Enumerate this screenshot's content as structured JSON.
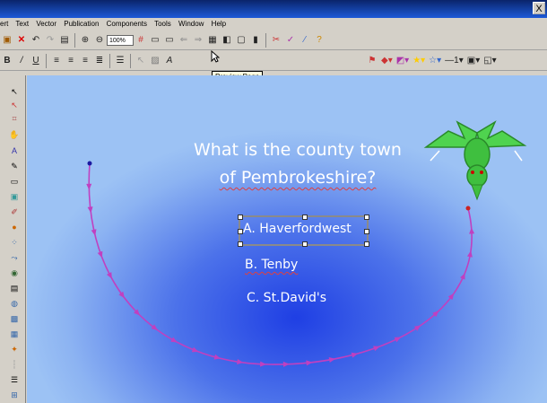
{
  "window": {
    "close_glyph": "X"
  },
  "menu": [
    "ert",
    "Text",
    "Vector",
    "Publication",
    "Components",
    "Tools",
    "Window",
    "Help"
  ],
  "toolbar": {
    "zoom_value": "100%",
    "tooltip": "Preview Page"
  },
  "slide": {
    "question_line1": "What is the county town",
    "question_line2": "of Pembrokeshire?",
    "answers": [
      "A. Haverfordwest",
      "B. Tenby",
      "C. St.David's"
    ]
  },
  "colors": {
    "path": "#c040c0",
    "canvas": "#4c72ea",
    "dragon": "#3fcf3f"
  }
}
